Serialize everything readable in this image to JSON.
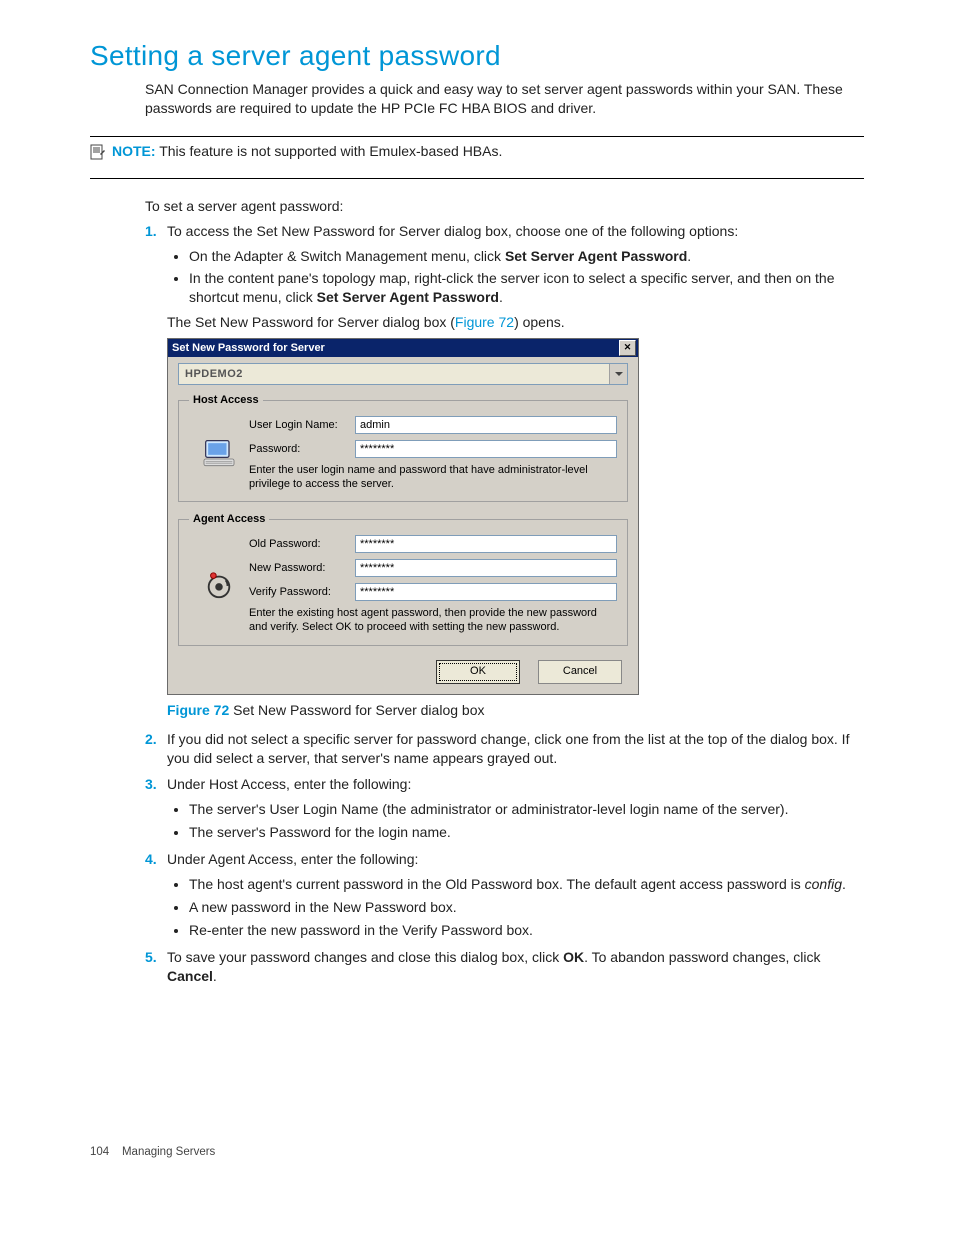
{
  "title": "Setting a server agent password",
  "intro": "SAN Connection Manager provides a quick and easy way to set server agent passwords within your SAN. These passwords are required to update the HP PCIe FC HBA BIOS and driver.",
  "note_label": "NOTE:",
  "note_text": "This feature is not supported with Emulex-based HBAs.",
  "lead_in": "To set a server agent password:",
  "step1_intro": "To access the Set New Password for Server dialog box, choose one of the following options:",
  "step1_b1_a": "On the Adapter & Switch Management menu, click ",
  "step1_b1_b": "Set Server Agent Password",
  "step1_b1_c": ".",
  "step1_b2_a": "In the content pane's topology map, right-click the server icon to select a specific server, and then on the shortcut menu, click ",
  "step1_b2_b": "Set Server Agent Password",
  "step1_b2_c": ".",
  "step1_after_a": "The Set New Password for Server dialog box (",
  "step1_after_link": "Figure 72",
  "step1_after_b": ") opens.",
  "dialog": {
    "title": "Set New Password for Server",
    "server_selected": "HPDEMO2",
    "host_legend": "Host Access",
    "user_login_label": "User Login Name:",
    "user_login_value": "admin",
    "password_label": "Password:",
    "password_value": "********",
    "host_helper": "Enter the user login name and password that have administrator-level privilege to access the server.",
    "agent_legend": "Agent Access",
    "old_pw_label": "Old Password:",
    "old_pw_value": "********",
    "new_pw_label": "New Password:",
    "new_pw_value": "********",
    "verify_pw_label": "Verify Password:",
    "verify_pw_value": "********",
    "agent_helper": "Enter the existing host agent password, then provide the new password and verify. Select OK to proceed with setting the new password.",
    "ok": "OK",
    "cancel": "Cancel"
  },
  "fig_label": "Figure 72",
  "fig_caption": "Set New Password for Server dialog box",
  "step2": "If you did not select a specific server for password change, click one from the list at the top of the dialog box. If you did select a server, that server's name appears grayed out.",
  "step3": "Under Host Access, enter the following:",
  "step3_b1": "The server's User Login Name (the administrator or administrator-level login name of the server).",
  "step3_b2": "The server's Password for the login name.",
  "step4": "Under Agent Access, enter the following:",
  "step4_b1_a": "The host agent's current password in the Old Password box. The default agent access password is ",
  "step4_b1_b": "config",
  "step4_b1_c": ".",
  "step4_b2": "A new password in the New Password box.",
  "step4_b3": "Re-enter the new password in the Verify Password box.",
  "step5_a": "To save your password changes and close this dialog box, click ",
  "step5_b": "OK",
  "step5_c": ". To abandon password changes, click ",
  "step5_d": "Cancel",
  "step5_e": ".",
  "footer_page": "104",
  "footer_sect": "Managing Servers"
}
